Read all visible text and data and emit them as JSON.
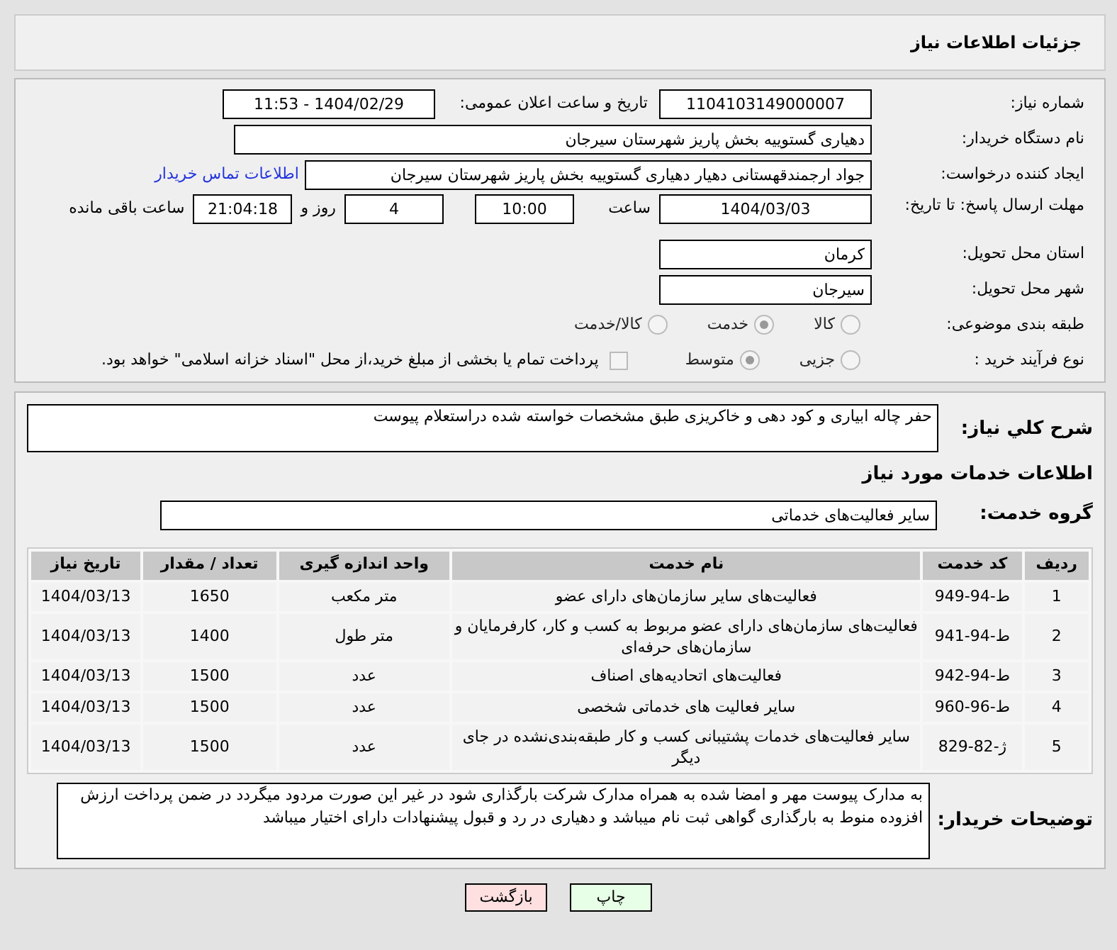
{
  "header": {
    "title": "جزئیات اطلاعات نیاز"
  },
  "details": {
    "need_number_label": "شماره نیاز:",
    "need_number": "1104103149000007",
    "announce_label": "تاریخ و ساعت اعلان عمومی:",
    "announce": "1404/02/29 - 11:53",
    "buyer_label": "نام دستگاه خریدار:",
    "buyer": "دهیاری گستوییه بخش پاریز شهرستان سیرجان",
    "creator_label": "ایجاد کننده درخواست:",
    "creator": "جواد ارجمندقهستانی دهیار دهیاری گستوییه بخش پاریز شهرستان سیرجان",
    "contact_link": "اطلاعات تماس خریدار",
    "deadline_label": "مهلت ارسال پاسخ: تا تاریخ:",
    "deadline_date": "1404/03/03",
    "time_label": "ساعت",
    "deadline_time": "10:00",
    "days": "4",
    "days_label": "روز و",
    "remaining": "21:04:18",
    "remaining_label": "ساعت باقی مانده",
    "province_label": "استان محل تحویل:",
    "province": "کرمان",
    "city_label": "شهر محل تحویل:",
    "city": "سیرجان",
    "category_label": "طبقه بندی موضوعی:",
    "category_options": [
      {
        "label": "کالا",
        "selected": false
      },
      {
        "label": "خدمت",
        "selected": true
      },
      {
        "label": "کالا/خدمت",
        "selected": false
      }
    ],
    "process_label": "نوع فرآیند خرید :",
    "process_options": [
      {
        "label": "جزیی",
        "selected": false
      },
      {
        "label": "متوسط",
        "selected": true
      }
    ],
    "treasury": {
      "label": "پرداخت تمام یا بخشی از مبلغ خرید،از محل \"اسناد خزانه اسلامی\" خواهد بود.",
      "checked": false
    }
  },
  "services": {
    "description_label": "شرح کلي نياز:",
    "description": "حفر چاله ابیاری  و کود دهی و خاکریزی طبق مشخصات خواسته شده دراستعلام پیوست",
    "section_title": "اطلاعات خدمات مورد نیاز",
    "group_label": "گروه خدمت:",
    "group": "سایر فعالیت‌های خدماتی",
    "table": {
      "columns": [
        "ردیف",
        "کد خدمت",
        "نام خدمت",
        "واحد اندازه گیری",
        "تعداد / مقدار",
        "تاریخ نیاز"
      ],
      "rows": [
        [
          "1",
          "ط-94-949",
          "فعالیت‌های سایر سازمان‌های دارای عضو",
          "متر مکعب",
          "1650",
          "1404/03/13"
        ],
        [
          "2",
          "ط-94-941",
          "فعالیت‌های سازمان‌های دارای عضو مربوط به کسب و کار، کارفرمایان و سازمان‌های حرفه‌ای",
          "متر طول",
          "1400",
          "1404/03/13"
        ],
        [
          "3",
          "ط-94-942",
          "فعالیت‌های اتحادیه‌های اصناف",
          "عدد",
          "1500",
          "1404/03/13"
        ],
        [
          "4",
          "ط-96-960",
          "سایر فعالیت های خدماتی شخصی",
          "عدد",
          "1500",
          "1404/03/13"
        ],
        [
          "5",
          "ژ-82-829",
          "سایر فعالیت‌های خدمات پشتیبانی کسب و کار طبقه‌بندی‌نشده در جای دیگر",
          "عدد",
          "1500",
          "1404/03/13"
        ]
      ]
    },
    "notes_label": "توضیحات خریدار:",
    "notes": "به مدارک پیوست مهر و امضا شده به همراه مدارک شرکت بارگذاری شود در غیر این صورت مردود میگردد در ضمن پرداخت ارزش افزوده منوط به بارگذاری گواهی ثبت نام میباشد و دهیاری در رد و قبول پیشنهادات دارای اختیار میباشد"
  },
  "buttons": [
    {
      "kind": "print",
      "label": "چاپ"
    },
    {
      "kind": "back",
      "label": "بازگشت"
    }
  ]
}
